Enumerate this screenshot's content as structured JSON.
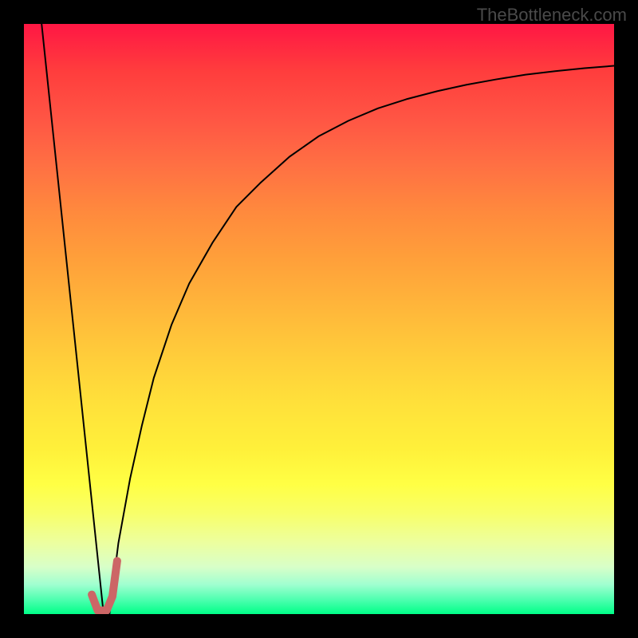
{
  "watermark": "TheBottleneck.com",
  "chart_data": {
    "type": "line",
    "title": "",
    "xlabel": "",
    "ylabel": "",
    "xlim": [
      0,
      100
    ],
    "ylim": [
      0,
      100
    ],
    "grid": false,
    "legend": false,
    "background": {
      "type": "vertical-gradient",
      "stops": [
        {
          "pos": 0,
          "color": "#ff1744"
        },
        {
          "pos": 50,
          "color": "#ffcc3a"
        },
        {
          "pos": 80,
          "color": "#ffff44"
        },
        {
          "pos": 100,
          "color": "#00ff88"
        }
      ]
    },
    "series": [
      {
        "name": "descending-line",
        "color": "#000000",
        "stroke_width": 2,
        "x": [
          3,
          13.5
        ],
        "y": [
          100,
          0
        ]
      },
      {
        "name": "curve",
        "color": "#000000",
        "stroke_width": 2,
        "x": [
          14.5,
          16,
          18,
          20,
          22,
          25,
          28,
          32,
          36,
          40,
          45,
          50,
          55,
          60,
          65,
          70,
          75,
          80,
          85,
          90,
          95,
          100
        ],
        "y": [
          0,
          12,
          23,
          32,
          40,
          49,
          56,
          63,
          69,
          73,
          77.5,
          81,
          83.6,
          85.7,
          87.3,
          88.6,
          89.7,
          90.6,
          91.4,
          92,
          92.5,
          92.9
        ]
      },
      {
        "name": "highlight-j",
        "color": "#cc6666",
        "stroke_width": 10,
        "x": [
          11.5,
          12.5,
          14.0,
          15.0,
          15.8
        ],
        "y": [
          3.3,
          0.6,
          0.6,
          3.0,
          9.0
        ]
      }
    ]
  }
}
